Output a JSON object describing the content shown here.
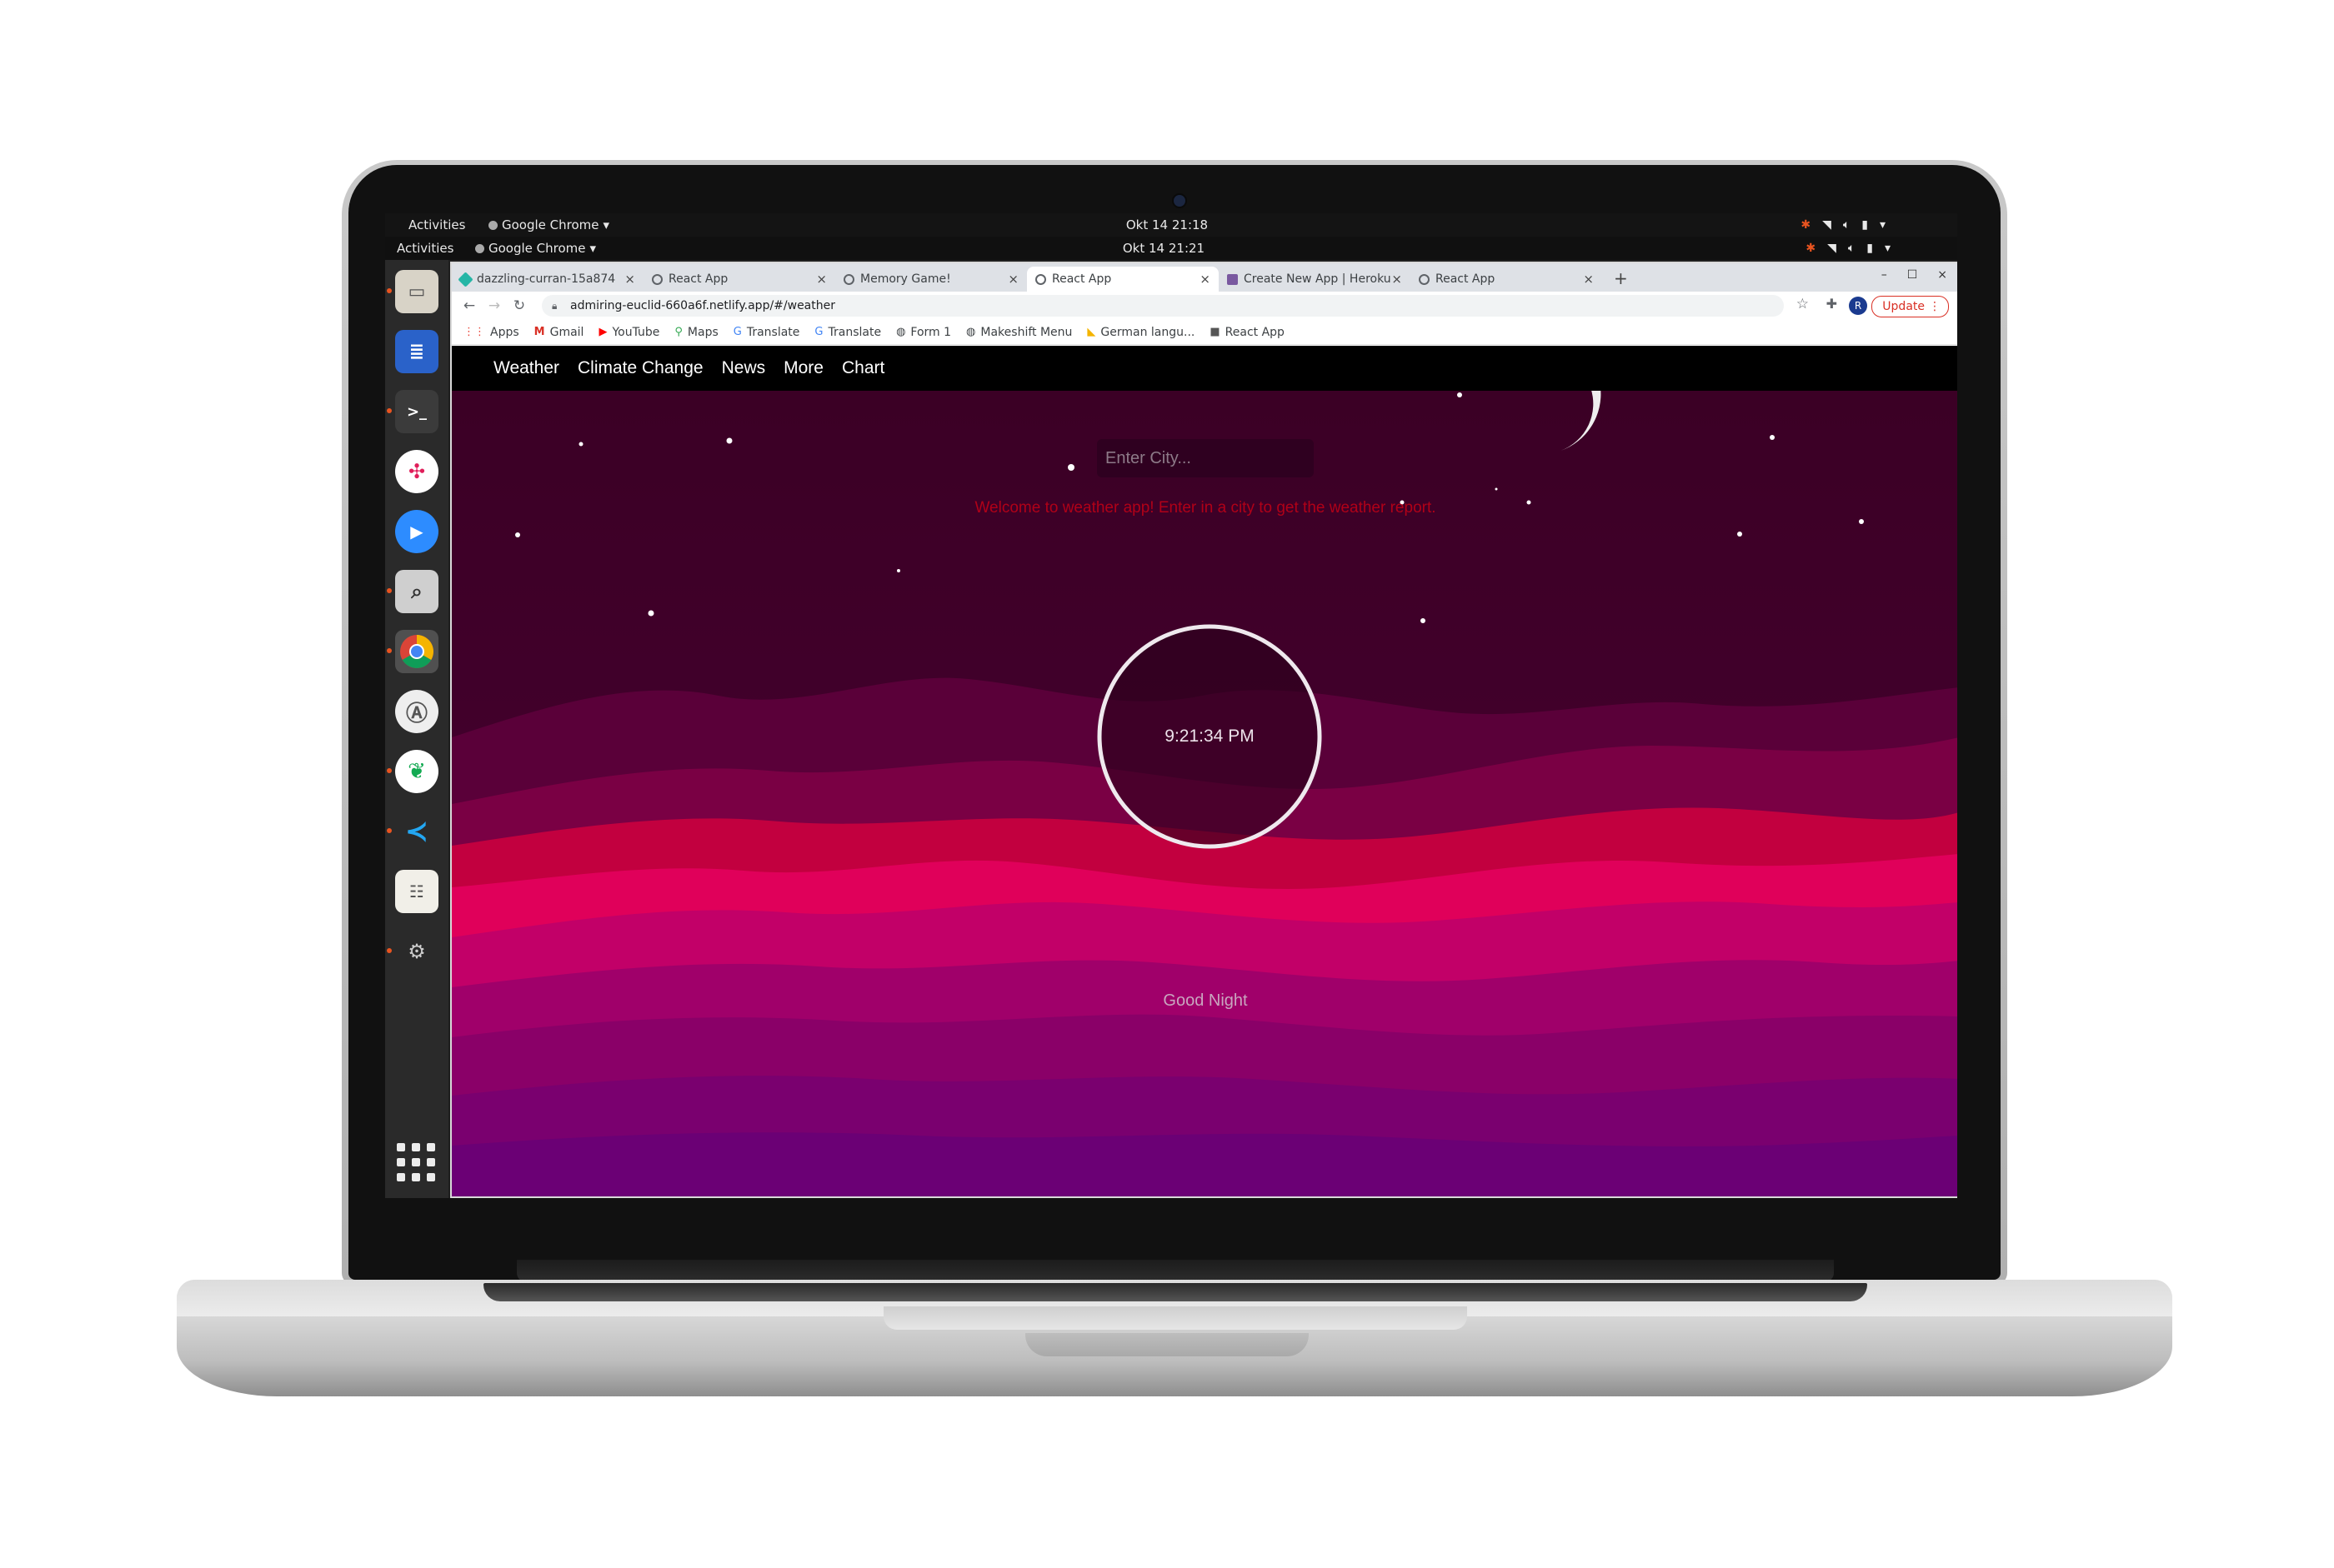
{
  "desktop": {
    "topbars": [
      {
        "activities": "Activities",
        "app_name": "Google Chrome",
        "clock": "Okt 14  21:18"
      },
      {
        "activities": "Activities",
        "app_name": "Google Chrome",
        "clock": "Okt 14  21:21"
      }
    ],
    "dock_items": [
      "files",
      "writer",
      "terminal",
      "slack",
      "zoom",
      "image-viewer",
      "chrome",
      "software",
      "mongodb-compass",
      "vscode",
      "notes",
      "rhythmbox"
    ],
    "show_apps_icon": "grid-icon"
  },
  "browser": {
    "tabs": [
      {
        "title": "dazzling-curran-15a874",
        "icon": "netlify-icon"
      },
      {
        "title": "React App",
        "icon": "globe-icon"
      },
      {
        "title": "Memory Game!",
        "icon": "globe-icon"
      },
      {
        "title": "React App",
        "icon": "globe-icon",
        "active": true
      },
      {
        "title": "Create New App | Heroku",
        "icon": "heroku-icon"
      },
      {
        "title": "React App",
        "icon": "globe-icon"
      }
    ],
    "url": "admiring-euclid-660a6f.netlify.app/#/weather",
    "profile_initial": "R",
    "update_label": "Update",
    "bookmarks": [
      {
        "label": "Apps",
        "icon": "apps-icon"
      },
      {
        "label": "Gmail",
        "icon": "gmail-icon"
      },
      {
        "label": "YouTube",
        "icon": "youtube-icon"
      },
      {
        "label": "Maps",
        "icon": "maps-icon"
      },
      {
        "label": "Translate",
        "icon": "translate-icon"
      },
      {
        "label": "Translate",
        "icon": "translate-icon"
      },
      {
        "label": "Form 1",
        "icon": "globe-icon"
      },
      {
        "label": "Makeshift Menu",
        "icon": "globe-icon"
      },
      {
        "label": "German langu...",
        "icon": "flag-icon"
      },
      {
        "label": "React App",
        "icon": "react-icon"
      }
    ]
  },
  "app": {
    "nav": [
      "Weather",
      "Climate Change",
      "News",
      "More",
      "Chart"
    ],
    "city_placeholder": "Enter City...",
    "welcome": "Welcome to weather app! Enter in a city to get the weather report.",
    "time": "9:21:34 PM",
    "greeting": "Good Night"
  },
  "colors": {
    "accent_red": "#b00018",
    "night_sky": "#3d0027",
    "nav_bg": "#000000",
    "chrome_update": "#d93025"
  }
}
